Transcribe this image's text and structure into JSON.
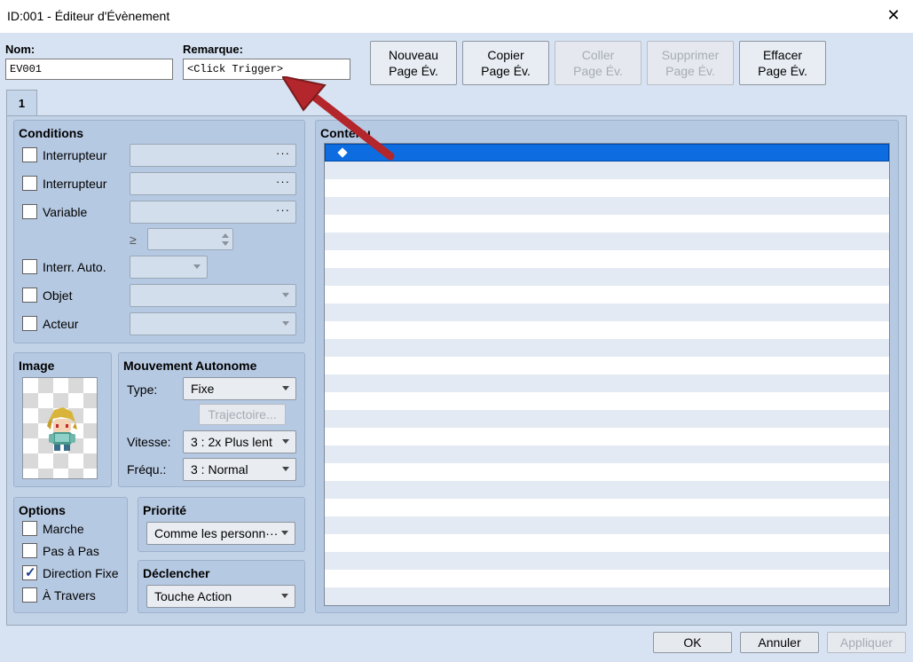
{
  "window": {
    "title": "ID:001 - Éditeur d'Évènement",
    "close_glyph": "✕"
  },
  "name_label": "Nom:",
  "name_value": "EV001",
  "note_label": "Remarque:",
  "note_value": "<Click Trigger>",
  "toolbar": {
    "new": [
      "Nouveau",
      "Page Év."
    ],
    "copy": [
      "Copier",
      "Page Év."
    ],
    "paste": [
      "Coller",
      "Page Év."
    ],
    "delete": [
      "Supprimer",
      "Page Év."
    ],
    "clear": [
      "Effacer",
      "Page Év."
    ]
  },
  "tab": "1",
  "conditions": {
    "title": "Conditions",
    "switch1": "Interrupteur",
    "switch2": "Interrupteur",
    "variable": "Variable",
    "ge": "≥",
    "self_switch": "Interr. Auto.",
    "item": "Objet",
    "actor": "Acteur",
    "dots": "···"
  },
  "image": {
    "title": "Image"
  },
  "movement": {
    "title": "Mouvement Autonome",
    "type_label": "Type:",
    "type_value": "Fixe",
    "route_button": "Trajectoire...",
    "speed_label": "Vitesse:",
    "speed_value": "3 : 2x Plus lent",
    "freq_label": "Fréqu.:",
    "freq_value": "3 : Normal"
  },
  "options": {
    "title": "Options",
    "walking": {
      "label": "Marche",
      "checked": false
    },
    "stepping": {
      "label": "Pas à Pas",
      "checked": false
    },
    "direction_fix": {
      "label": "Direction Fixe",
      "checked": true
    },
    "through": {
      "label": "À Travers",
      "checked": false
    }
  },
  "priority": {
    "title": "Priorité",
    "value": "Comme les personn···"
  },
  "trigger": {
    "title": "Déclencher",
    "value": "Touche Action"
  },
  "contents": {
    "title": "Contenu"
  },
  "footer": {
    "ok": "OK",
    "cancel": "Annuler",
    "apply": "Appliquer"
  },
  "colors": {
    "selection": "#0d6de0",
    "annotation_arrow": "#b3262b"
  }
}
